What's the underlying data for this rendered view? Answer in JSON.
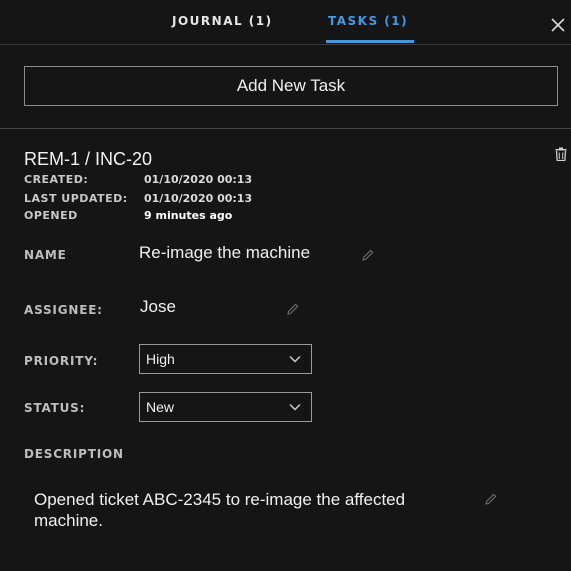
{
  "tabs": {
    "journal": "JOURNAL (1)",
    "tasks": "TASKS (1)",
    "active": "tasks"
  },
  "header": {
    "close_label": "×"
  },
  "actions": {
    "add_task_label": "Add New Task"
  },
  "task": {
    "id": "REM-1 / INC-20",
    "created_label": "CREATED:",
    "created_value": "01/10/2020 00:13",
    "updated_label": "LAST UPDATED:",
    "updated_value": "01/10/2020 00:13",
    "opened_label": "OPENED",
    "opened_value": "9 minutes ago",
    "name_label": "NAME",
    "name_value": "Re-image the machine",
    "assignee_label": "ASSIGNEE:",
    "assignee_value": "Jose",
    "priority_label": "PRIORITY:",
    "priority_value": "High",
    "status_label": "STATUS:",
    "status_value": "New",
    "description_label": "DESCRIPTION",
    "description_value": "Opened ticket ABC-2345 to re-image the affected machine."
  },
  "icons": {
    "close": "close-icon",
    "delete": "trash-icon",
    "edit": "pencil-icon",
    "dropdown": "chevron-down-icon"
  },
  "colors": {
    "background": "#151515",
    "accent": "#3d9ce8",
    "border": "#8c8c8c",
    "text": "#f0f0f0"
  }
}
